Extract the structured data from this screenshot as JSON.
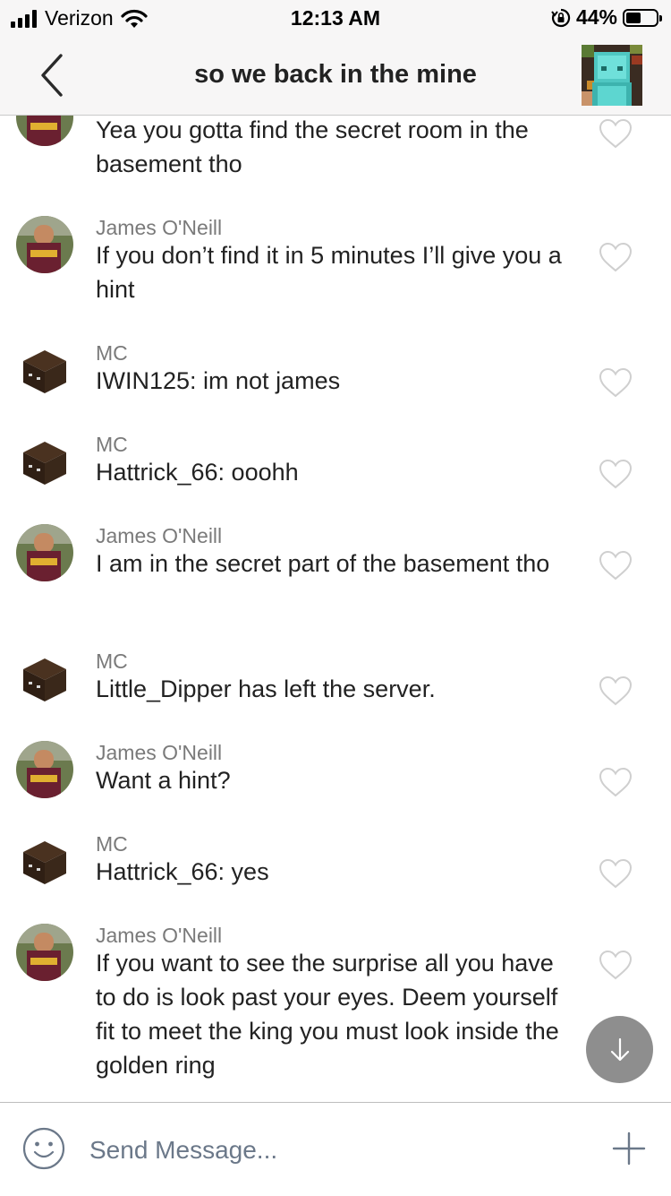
{
  "status_bar": {
    "carrier": "Verizon",
    "time": "12:13 AM",
    "battery": "44%",
    "battery_level": 0.44,
    "icons": [
      "signal-icon",
      "wifi-icon",
      "rotation-lock-icon",
      "battery-icon"
    ]
  },
  "header": {
    "title": "so we back in the mine",
    "back_icon": "chevron-left-icon"
  },
  "messages": [
    {
      "sender": "",
      "text": "Yea you gotta find the secret room in the basement tho",
      "avatar": "photo"
    },
    {
      "sender": "James O'Neill",
      "text": "If you don’t find it in 5 minutes I’ll give you a hint",
      "avatar": "photo"
    },
    {
      "sender": "MC",
      "text": "IWIN125: im not james",
      "avatar": "cube"
    },
    {
      "sender": "MC",
      "text": "Hattrick_66: ooohh",
      "avatar": "cube"
    },
    {
      "sender": "James O'Neill",
      "text": "I am in the secret part of the basement tho",
      "avatar": "photo"
    },
    {
      "sender": "MC",
      "text": "Little_Dipper has left the server.",
      "avatar": "cube"
    },
    {
      "sender": "James O'Neill",
      "text": "Want a hint?",
      "avatar": "photo"
    },
    {
      "sender": "MC",
      "text": "Hattrick_66: yes",
      "avatar": "cube"
    },
    {
      "sender": "James O'Neill",
      "text": "If you want to see the surprise all you have to do is look past your eyes. Deem yourself fit to meet the king you must look inside the golden ring",
      "avatar": "photo"
    }
  ],
  "composer": {
    "placeholder": "Send Message...",
    "emoji_icon": "smiley-icon",
    "add_icon": "plus-icon"
  },
  "scroll_button_icon": "arrow-down-icon",
  "colors": {
    "bar_background": "#f7f6f6",
    "sender_gray": "#7a7a7a",
    "placeholder": "#6b7889",
    "scroll_button": "#8e8e8e"
  }
}
